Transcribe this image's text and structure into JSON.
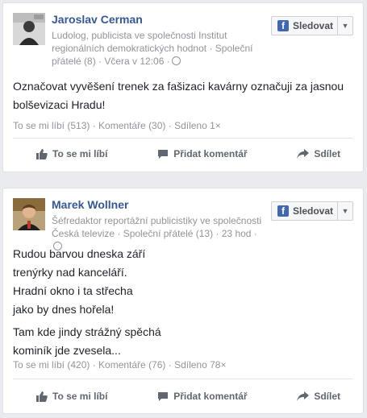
{
  "posts": [
    {
      "author": "Jaroslav Cerman",
      "meta": "Ludolog, publicista ve společnosti Institut regionálních demokratických hodnot · Společní přátelé (8) · Včera v 12:06 ·",
      "follow_label": "Sledovat",
      "fb_glyph": "f",
      "body": [
        "Označovat vyvěšení trenek za fašizaci kavárny označuji za jasnou bolševizaci Hradu!"
      ],
      "stats": "To se mi líbí (513) · Komentáře (30) · Sdíleno 1×",
      "actions": {
        "like": "To se mi líbí",
        "comment": "Přidat komentář",
        "share": "Sdílet"
      }
    },
    {
      "author": "Marek Wollner",
      "meta": "Šéfredaktor reportážní publicistiky ve společnosti Česká televize · Společní přátelé (13) · 23 hod ·",
      "follow_label": "Sledovat",
      "fb_glyph": "f",
      "body": [
        "Rudou barvou dneska září",
        "trenýrky nad kanceláří.",
        "Hradní okno i ta střecha",
        "jako by dnes hořela!",
        "Tam kde jindy strážný spěchá",
        "kominík jde zvesela..."
      ],
      "stats": "To se mi líbí (420) · Komentáře (76) · Sdíleno 78×",
      "actions": {
        "like": "To se mi líbí",
        "comment": "Přidat komentář",
        "share": "Sdílet"
      }
    }
  ],
  "colors": {
    "link": "#365899",
    "meta": "#90949c",
    "action": "#616770",
    "fb_blue": "#4267b2"
  }
}
